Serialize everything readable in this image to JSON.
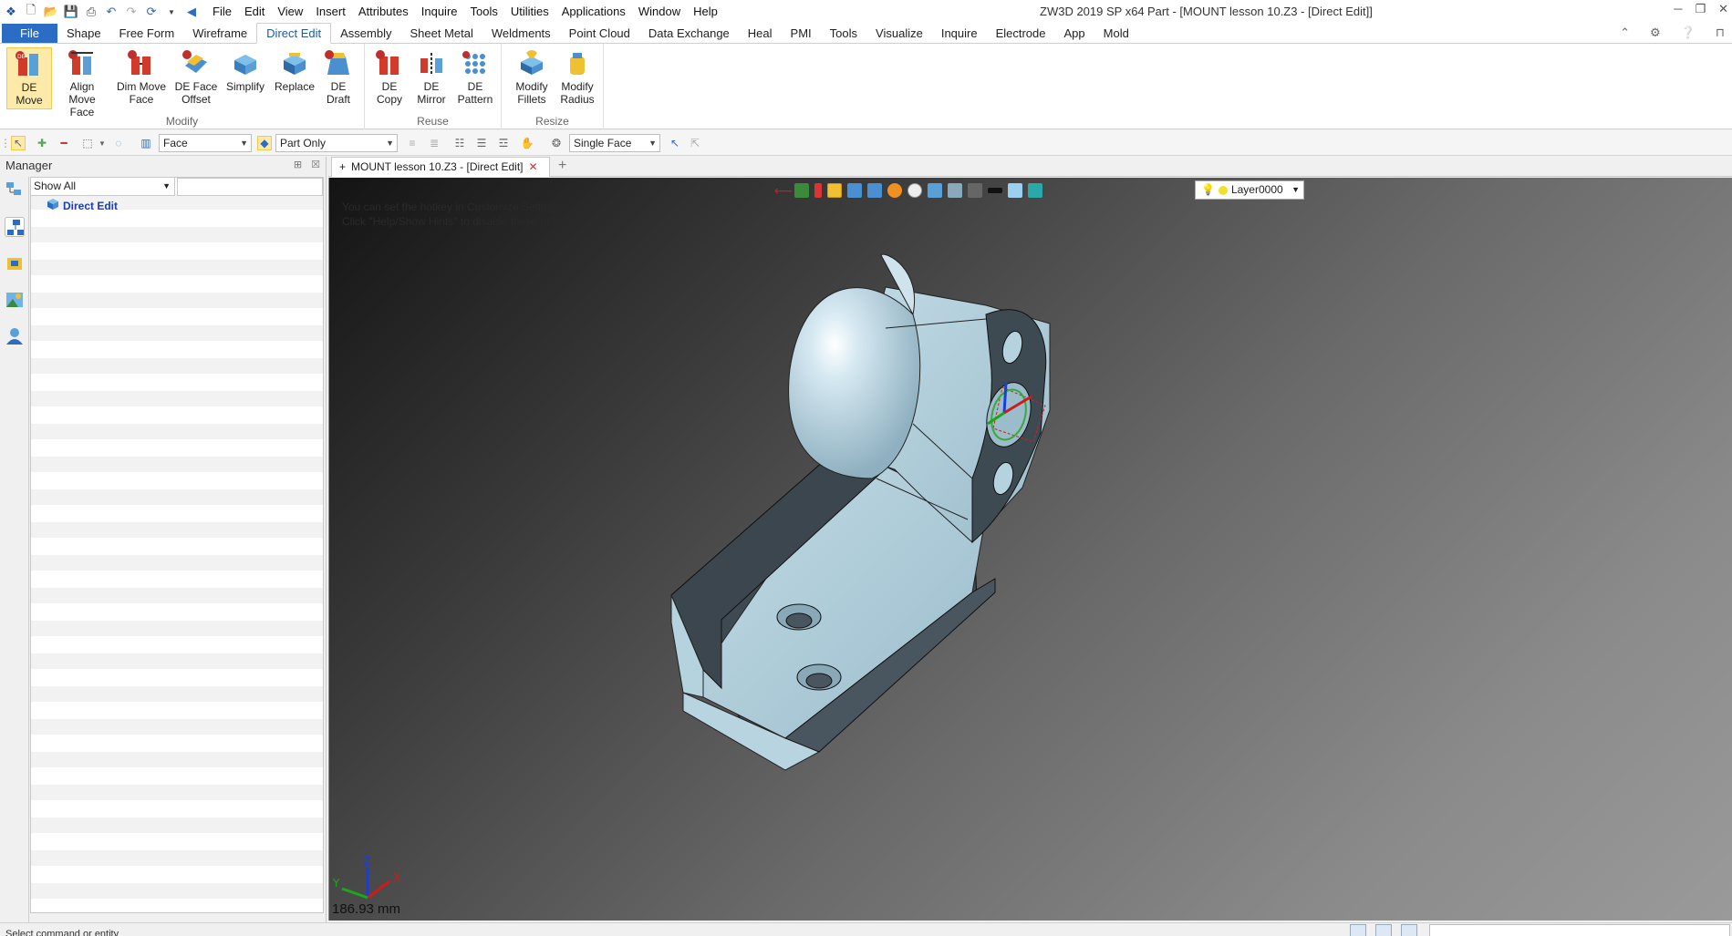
{
  "titlebar": {
    "menus": [
      "File",
      "Edit",
      "View",
      "Insert",
      "Attributes",
      "Inquire",
      "Tools",
      "Utilities",
      "Applications",
      "Window",
      "Help"
    ],
    "app_title": "ZW3D 2019 SP x64",
    "doc_title": "Part - [MOUNT lesson 10.Z3 - [Direct Edit]]"
  },
  "ribbon_tabs": {
    "file": "File",
    "tabs": [
      "Shape",
      "Free Form",
      "Wireframe",
      "Direct Edit",
      "Assembly",
      "Sheet Metal",
      "Weldments",
      "Point Cloud",
      "Data Exchange",
      "Heal",
      "PMI",
      "Tools",
      "Visualize",
      "Inquire",
      "Electrode",
      "App",
      "Mold"
    ],
    "active": "Direct Edit"
  },
  "ribbon": {
    "modify": {
      "label": "Modify",
      "buttons": [
        {
          "label": "DE\nMove",
          "active": true
        },
        {
          "label": "Align\nMove Face"
        },
        {
          "label": "Dim Move\nFace"
        },
        {
          "label": "DE Face\nOffset"
        },
        {
          "label": "Simplify"
        },
        {
          "label": "Replace"
        },
        {
          "label": "DE\nDraft"
        }
      ]
    },
    "reuse": {
      "label": "Reuse",
      "buttons": [
        {
          "label": "DE\nCopy"
        },
        {
          "label": "DE\nMirror"
        },
        {
          "label": "DE\nPattern"
        }
      ]
    },
    "resize": {
      "label": "Resize",
      "buttons": [
        {
          "label": "Modify\nFillets"
        },
        {
          "label": "Modify\nRadius"
        }
      ]
    }
  },
  "filterbar": {
    "filter": "Face",
    "scope": "Part Only",
    "pick_mode": "Single Face"
  },
  "manager": {
    "title": "Manager",
    "show_filter": "Show All",
    "tree_root": "Direct Edit"
  },
  "document": {
    "tab_label": "MOUNT lesson 10.Z3 - [Direct Edit]",
    "hint_line1": "You can set the hotkey in Customize Settings.",
    "hint_line2": "Click \"Help/Show Hints\" to disable these hints.",
    "layer": "Layer0000",
    "distance": "186.93 mm",
    "axis_labels": {
      "x": "X",
      "y": "Y",
      "z": "Z"
    }
  },
  "status": {
    "message": "Select command or entity"
  },
  "colors": {
    "ribbon_file": "#2b6cc4",
    "active_button": "#fde9a8",
    "model_face": "#aecbd8",
    "model_dark": "#3e4a52",
    "tree_item": "#1a3fb8"
  }
}
